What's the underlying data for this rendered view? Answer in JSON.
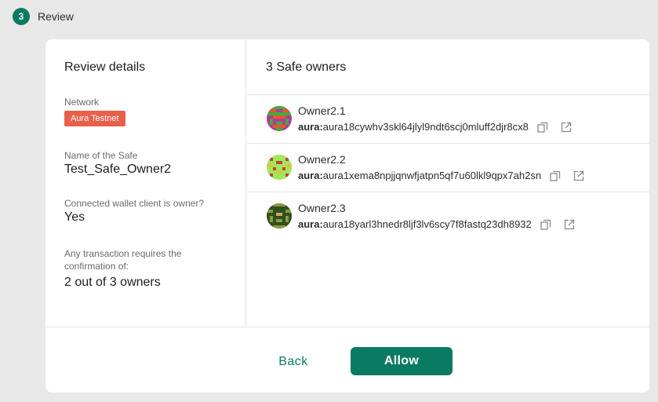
{
  "step": {
    "number": "3",
    "label": "Review"
  },
  "review": {
    "title": "Review details",
    "network_label": "Network",
    "network_value": "Aura Testnet",
    "safe_name_label": "Name of the Safe",
    "safe_name_value": "Test_Safe_Owner2",
    "wallet_owner_label": "Connected wallet client is owner?",
    "wallet_owner_value": "Yes",
    "threshold_label": "Any transaction requires the confirmation of:",
    "threshold_value": "2 out of 3 owners"
  },
  "owners": {
    "title": "3 Safe owners",
    "items": [
      {
        "name": "Owner2.1",
        "prefix": "aura:",
        "address": "aura18cywhv3skl64jlyl9ndt6scj0mluff2djr8cx8",
        "avatar": "avatar-magenta-green"
      },
      {
        "name": "Owner2.2",
        "prefix": "aura:",
        "address": "aura1xema8npjjqnwfjatpn5qf7u60lkl9qpx7ah2sn",
        "avatar": "avatar-lime-red"
      },
      {
        "name": "Owner2.3",
        "prefix": "aura:",
        "address": "aura18yarl3hnedr8ljf3lv6scy7f8fastq23dh8932",
        "avatar": "avatar-darkgreen-olive"
      }
    ]
  },
  "footer": {
    "back_label": "Back",
    "allow_label": "Allow"
  },
  "colors": {
    "accent": "#0a7a62",
    "network_badge": "#e8604a"
  }
}
